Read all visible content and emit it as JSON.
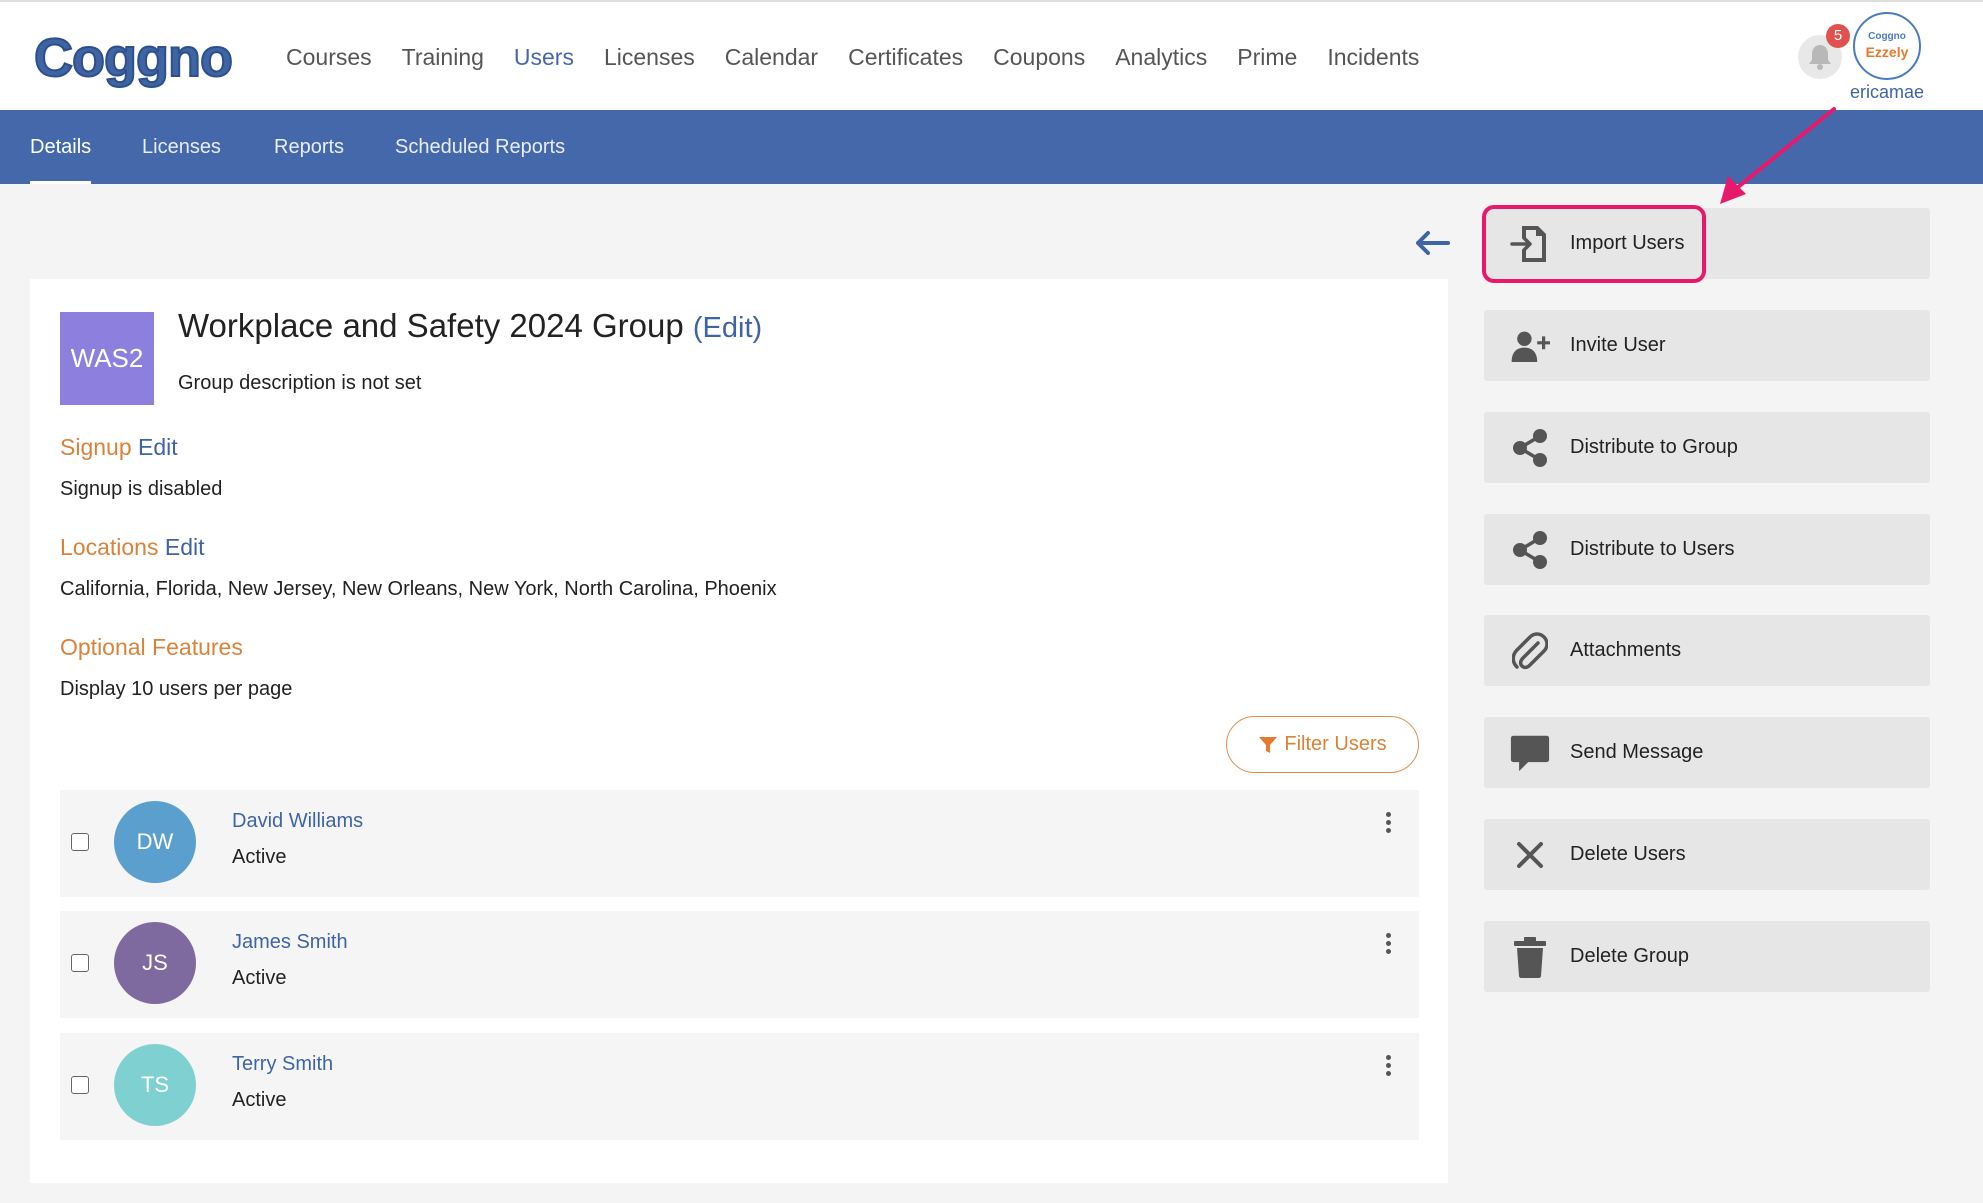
{
  "brand": {
    "logo_text": "Coggno"
  },
  "top_nav": {
    "items": [
      "Courses",
      "Training",
      "Users",
      "Licenses",
      "Calendar",
      "Certificates",
      "Coupons",
      "Analytics",
      "Prime",
      "Incidents"
    ],
    "active": "Users"
  },
  "notifications": {
    "count": "5"
  },
  "account": {
    "avatar_line1": "Coggno",
    "avatar_line2": "Ezzely",
    "username": "ericamae"
  },
  "sub_nav": {
    "items": [
      "Details",
      "Licenses",
      "Reports",
      "Scheduled Reports"
    ],
    "active": "Details"
  },
  "group": {
    "avatar": "WAS2",
    "title": "Workplace and Safety 2024 Group",
    "edit_label": "(Edit)",
    "description": "Group description is not set",
    "signup": {
      "heading": "Signup",
      "edit": "Edit",
      "text": "Signup is disabled"
    },
    "locations": {
      "heading": "Locations",
      "edit": "Edit",
      "text": "California, Florida, New Jersey, New Orleans, New York, North Carolina, Phoenix"
    },
    "optional": {
      "heading": "Optional Features",
      "text": "Display 10 users per page"
    }
  },
  "filter_button": "Filter Users",
  "users": [
    {
      "initials": "DW",
      "name": "David Williams",
      "status": "Active",
      "color": "#5b9fcf"
    },
    {
      "initials": "JS",
      "name": "James Smith",
      "status": "Active",
      "color": "#7e6a9e"
    },
    {
      "initials": "TS",
      "name": "Terry Smith",
      "status": "Active",
      "color": "#7fd1d1"
    }
  ],
  "actions": [
    {
      "label": "Import Users",
      "icon": "file-import-icon"
    },
    {
      "label": "Invite User",
      "icon": "user-plus-icon"
    },
    {
      "label": "Distribute to Group",
      "icon": "share-icon"
    },
    {
      "label": "Distribute to Users",
      "icon": "share-icon"
    },
    {
      "label": "Attachments",
      "icon": "paperclip-icon"
    },
    {
      "label": "Send Message",
      "icon": "comment-icon"
    },
    {
      "label": "Delete Users",
      "icon": "close-icon"
    },
    {
      "label": "Delete Group",
      "icon": "trash-icon"
    }
  ],
  "colors": {
    "primary": "#4468aa",
    "accent": "#d9823a",
    "highlight": "#e8196b"
  }
}
